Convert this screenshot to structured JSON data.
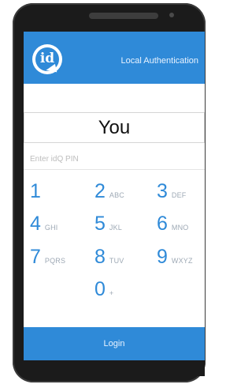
{
  "header": {
    "logo_text": "id",
    "title": "Local Authentication"
  },
  "user": {
    "name": "You"
  },
  "pin": {
    "placeholder": "Enter idQ PIN",
    "value": ""
  },
  "keypad": [
    {
      "digit": "1",
      "letters": ""
    },
    {
      "digit": "2",
      "letters": "ABC"
    },
    {
      "digit": "3",
      "letters": "DEF"
    },
    {
      "digit": "4",
      "letters": "GHI"
    },
    {
      "digit": "5",
      "letters": "JKL"
    },
    {
      "digit": "6",
      "letters": "MNO"
    },
    {
      "digit": "7",
      "letters": "PQRS"
    },
    {
      "digit": "8",
      "letters": "TUV"
    },
    {
      "digit": "9",
      "letters": "WXYZ"
    },
    {
      "digit": "0",
      "letters": "+"
    }
  ],
  "login": {
    "label": "Login"
  },
  "colors": {
    "accent": "#2f8ad8",
    "phone_body": "#1b1b1b"
  }
}
